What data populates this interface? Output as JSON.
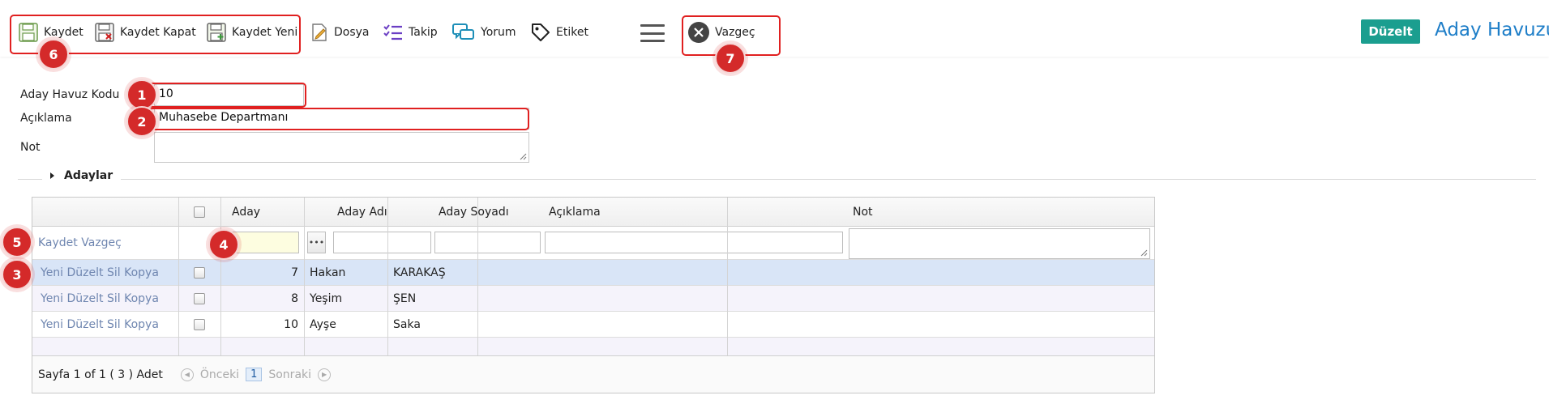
{
  "toolbar": {
    "kaydet": "Kaydet",
    "kaydet_kapat": "Kaydet Kapat",
    "kaydet_yeni": "Kaydet Yeni",
    "dosya": "Dosya",
    "takip": "Takip",
    "yorum": "Yorum",
    "etiket": "Etiket",
    "vazgec": "Vazgeç",
    "duzelt": "Düzelt"
  },
  "page_title": "Aday Havuzu",
  "form": {
    "code_label": "Aday Havuz Kodu",
    "code_value": "10",
    "desc_label": "Açıklama",
    "desc_value": "Muhasebe Departmanı",
    "note_label": "Not",
    "note_value": ""
  },
  "section": {
    "title": "Adaylar"
  },
  "grid": {
    "headers": [
      "Aday",
      "Aday Adı",
      "Aday Soyadı",
      "Açıklama",
      "Not"
    ],
    "edit_row": {
      "save": "Kaydet",
      "cancel": "Vazgeç"
    },
    "row_actions": {
      "new": "Yeni",
      "edit": "Düzelt",
      "delete": "Sil",
      "copy": "Kopya"
    },
    "rows": [
      {
        "aday": "7",
        "ad": "Hakan",
        "soyad": "KARAKAŞ",
        "aciklama": "",
        "not": ""
      },
      {
        "aday": "8",
        "ad": "Yeşim",
        "soyad": "ŞEN",
        "aciklama": "",
        "not": ""
      },
      {
        "aday": "10",
        "ad": "Ayşe",
        "soyad": "Saka",
        "aciklama": "",
        "not": ""
      }
    ],
    "pager": {
      "summary": "Sayfa 1 of 1 ( 3 ) Adet",
      "prev": "Önceki",
      "page": "1",
      "next": "Sonraki"
    }
  },
  "annotations": [
    "1",
    "2",
    "3",
    "4",
    "5",
    "6",
    "7"
  ],
  "colors": {
    "accent": "#1b9e8f",
    "title": "#1e7ec8",
    "highlight": "#e02020",
    "selected_row": "#d9e5f7",
    "alt_row": "#f5f3fb"
  }
}
